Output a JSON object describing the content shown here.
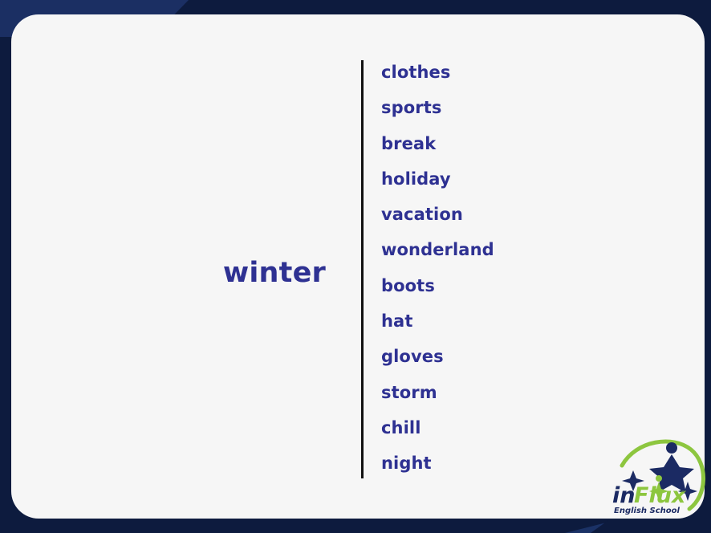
{
  "slide": {
    "prompt_word": "winter",
    "associations": [
      "clothes",
      "sports",
      "break",
      "holiday",
      "vacation",
      "wonderland",
      "boots",
      "hat",
      "gloves",
      "storm",
      "chill",
      "night"
    ]
  },
  "logo": {
    "name_part_one": "in",
    "name_part_two": "Flux",
    "trademark": "®",
    "tagline": "English School",
    "icon_name": "influx-star-logo"
  },
  "colors": {
    "background_navy": "#0d1b3e",
    "wedge_navy_light": "#1b3266",
    "card_background": "#f6f6f6",
    "text_indigo": "#2e3192",
    "divider_black": "#111111",
    "logo_green": "#8dc63f",
    "logo_navy": "#1b2a63"
  }
}
